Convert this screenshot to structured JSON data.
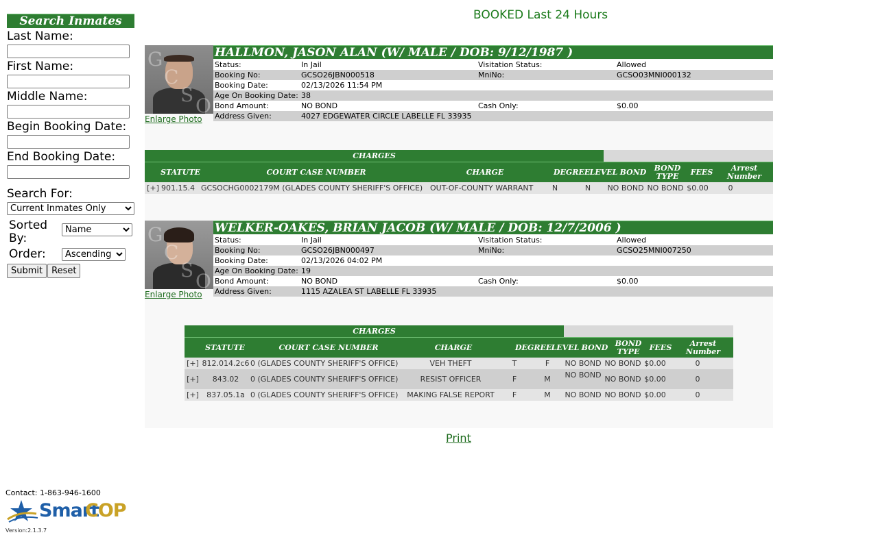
{
  "sidebar": {
    "title": "Search Inmates",
    "last_name_label": "Last Name:",
    "first_name_label": "First Name:",
    "middle_name_label": "Middle Name:",
    "begin_booking_label": "Begin Booking Date:",
    "end_booking_label": "End Booking Date:",
    "search_for_label": "Search For:",
    "search_for_value": "Current Inmates Only",
    "sorted_by_label": "Sorted By:",
    "sorted_by_value": "Name",
    "order_label": "Order:",
    "order_value": "Ascending",
    "submit_label": "Submit",
    "reset_label": "Reset"
  },
  "page_title": "BOOKED Last 24 Hours",
  "detail_labels": {
    "status": "Status:",
    "visitation": "Visitation Status:",
    "booking_no": "Booking No:",
    "mnino": "MniNo:",
    "booking_date": "Booking Date:",
    "age": "Age On Booking Date:",
    "bond_amount": "Bond Amount:",
    "cash_only": "Cash Only:",
    "address": "Address Given:"
  },
  "charge_labels": {
    "title": "CHARGES",
    "statute": "STATUTE",
    "court_case": "COURT CASE NUMBER",
    "charge": "CHARGE",
    "degree": "DEGREE",
    "level": "LEVEL",
    "bond": "BOND",
    "bond_type": "BOND TYPE",
    "fees": "FEES",
    "arrest_number": "Arrest Number"
  },
  "enlarge_label": "Enlarge Photo",
  "inmates": [
    {
      "name_header": "HALLMON, JASON ALAN   (W/ MALE / DOB: 9/12/1987 )",
      "status": "In Jail",
      "visitation": "Allowed",
      "booking_no": "GCSO26JBN000518",
      "mnino": "GCSO03MNI000132",
      "booking_date": "02/13/2026 11:54 PM",
      "age": "38",
      "bond_amount": "NO BOND",
      "cash_only": "$0.00",
      "address": "4027 EDGEWATER CIRCLE LABELLE FL 33935",
      "charges": [
        {
          "expand": "[+]",
          "statute": "901.15.4",
          "court_case": "GCSOCHG0002179M (GLADES COUNTY SHERIFF'S OFFICE)",
          "charge": "OUT-OF-COUNTY WARRANT",
          "degree": "N",
          "level": "N",
          "bond": "NO BOND",
          "bond_type": "NO BOND",
          "fees": "$0.00",
          "arrest_number": "0"
        }
      ]
    },
    {
      "name_header": "WELKER-OAKES, BRIAN JACOB   (W/ MALE / DOB: 12/7/2006 )",
      "status": "In Jail",
      "visitation": "Allowed",
      "booking_no": "GCSO26JBN000497",
      "mnino": "GCSO25MNI007250",
      "booking_date": "02/13/2026 04:02 PM",
      "age": "19",
      "bond_amount": "NO BOND",
      "cash_only": "$0.00",
      "address": "1115 AZALEA ST LABELLE FL 33935",
      "charges": [
        {
          "expand": "[+]",
          "statute": "812.014.2c6",
          "court_case": "0 (GLADES COUNTY SHERIFF'S OFFICE)",
          "charge": "VEH THEFT",
          "degree": "T",
          "level": "F",
          "bond": "NO BOND",
          "bond_type": "NO BOND",
          "fees": "$0.00",
          "arrest_number": "0"
        },
        {
          "expand": "[+]",
          "statute": "843.02",
          "court_case": "0 (GLADES COUNTY SHERIFF'S OFFICE)",
          "charge": "RESIST OFFICER",
          "degree": "F",
          "level": "M",
          "bond": "NO BOND",
          "bond_type": "NO BOND",
          "fees": "$0.00",
          "arrest_number": "0"
        },
        {
          "expand": "[+]",
          "statute": "837.05.1a",
          "court_case": "0 (GLADES COUNTY SHERIFF'S OFFICE)",
          "charge": "MAKING FALSE REPORT",
          "degree": "F",
          "level": "M",
          "bond": "NO BOND",
          "bond_type": "NO BOND",
          "fees": "$0.00",
          "arrest_number": "0"
        }
      ]
    }
  ],
  "print_label": "Print",
  "footer": {
    "contact": "Contact: 1-863-946-1600",
    "logo_text_smart": "Smart",
    "logo_text_cop": "COP",
    "version": "Version:2.1.3.7"
  },
  "colors": {
    "header_green": "#2e7d32",
    "title_green": "#1a7a1a",
    "row_shade": "#cfcfcf",
    "logo_blue": "#1f5fa8",
    "logo_gold": "#c9a227"
  }
}
